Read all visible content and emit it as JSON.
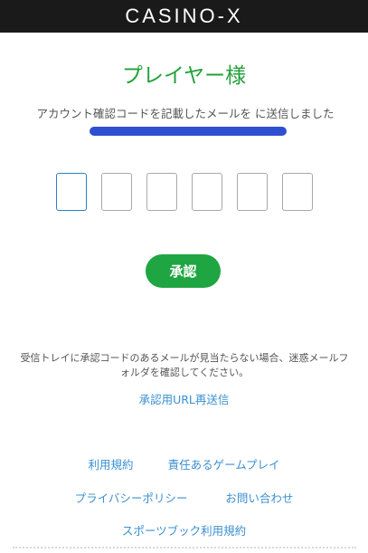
{
  "header": {
    "logo": "CASINO-X"
  },
  "main": {
    "title": "プレイヤー様",
    "message_prefix": "アカウント確認コードを記載したメールを に送信しました",
    "code_inputs": [
      "",
      "",
      "",
      "",
      "",
      ""
    ],
    "approve_label": "承認",
    "notice": "受信トレイに承認コードのあるメールが見当たらない場合、迷惑メールフォルダを確認してください。",
    "resend_label": "承認用URL再送信"
  },
  "footer": {
    "terms": "利用規約",
    "responsible_gaming": "責任あるゲームプレイ",
    "privacy": "プライバシーポリシー",
    "contact": "お問い合わせ",
    "sportsbook_terms": "スポーツブック利用規約"
  },
  "colors": {
    "header_bg": "#1a1a1a",
    "title_green": "#23a23a",
    "button_green": "#1fa541",
    "link_blue": "#3a8fd0",
    "redaction_blue": "#2f4fd0"
  }
}
